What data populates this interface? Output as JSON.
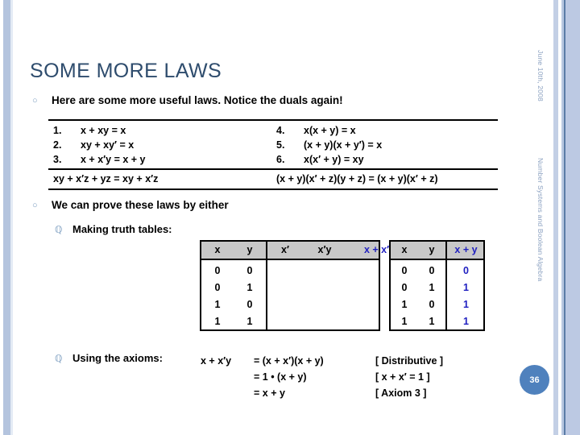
{
  "slide": {
    "title": "SOME MORE LAWS",
    "page_number": "36",
    "accent_color": "#2e4c6d",
    "badge_color": "#4f81bd",
    "side_bar_color": "#b4c4de",
    "formula_accent_color": "#2020c0"
  },
  "side_captions": {
    "date": "June 10th, 2008",
    "topic": "Number Systems and Boolean Algebra"
  },
  "bullets": {
    "marker_level1": "○",
    "marker_level2": "ℚ",
    "intro": "Here are some more useful laws. Notice the duals again!",
    "prove": "We can prove these laws by either",
    "truth_tables": "Making truth tables:",
    "axioms": "Using the axioms:"
  },
  "laws_table": {
    "left": [
      {
        "num": "1.",
        "expr": "x + xy = x"
      },
      {
        "num": "2.",
        "expr": "xy + xy′ = x"
      },
      {
        "num": "3.",
        "expr": "x + x′y = x + y"
      }
    ],
    "right": [
      {
        "num": "4.",
        "expr": "x(x + y) = x"
      },
      {
        "num": "5.",
        "expr": "(x + y)(x + y′) = x"
      },
      {
        "num": "6.",
        "expr": "x(x′ + y) = xy"
      }
    ],
    "dual_left": "xy + x′z + yz = xy + x′z",
    "dual_right": "(x + y)(x′ + z)(y + z) = (x + y)(x′ + z)"
  },
  "truth_table_1": {
    "headers_input": [
      "x",
      "y"
    ],
    "headers_output": [
      "x′",
      "x′y",
      "x + x′y"
    ],
    "accent_header_index": 2,
    "rows_input": [
      [
        "0",
        "0"
      ],
      [
        "0",
        "1"
      ],
      [
        "1",
        "0"
      ],
      [
        "1",
        "1"
      ]
    ],
    "rows_output": [
      [
        "",
        "",
        ""
      ],
      [
        "",
        "",
        ""
      ],
      [
        "",
        "",
        ""
      ],
      [
        "",
        "",
        ""
      ]
    ]
  },
  "truth_table_2": {
    "headers_input": [
      "x",
      "y"
    ],
    "headers_output": [
      "x + y"
    ],
    "accent_header_index": 0,
    "rows_input": [
      [
        "0",
        "0"
      ],
      [
        "0",
        "1"
      ],
      [
        "1",
        "0"
      ],
      [
        "1",
        "1"
      ]
    ],
    "rows_output": [
      [
        "0"
      ],
      [
        "1"
      ],
      [
        "1"
      ],
      [
        "1"
      ]
    ]
  },
  "proof": {
    "lhs": "x + x′y",
    "steps": [
      "= (x + x′)(x + y)",
      "= 1 • (x + y)",
      "= x + y"
    ],
    "reasons": [
      "[ Distributive ]",
      "[ x + x′ = 1 ]",
      "[ Axiom 3 ]"
    ]
  }
}
